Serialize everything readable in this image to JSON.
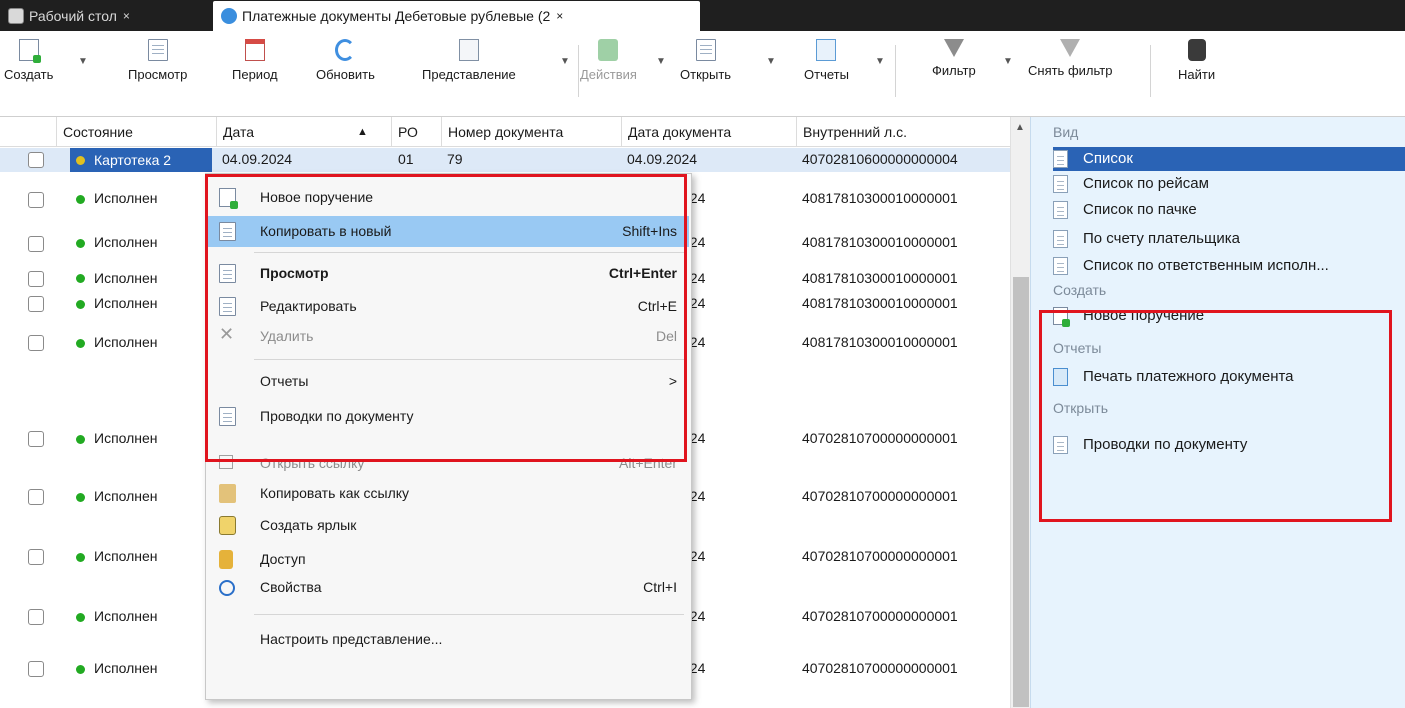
{
  "tabs": [
    {
      "label": "Рабочий стол",
      "close": "×",
      "active": false
    },
    {
      "label": "Платежные документы Дебетовые рублевые (2",
      "close": "×",
      "active": true
    }
  ],
  "toolbar": {
    "create": "Создать",
    "view": "Просмотр",
    "period": "Период",
    "refresh": "Обновить",
    "representation": "Представление",
    "actions": "Действия",
    "open": "Открыть",
    "reports": "Отчеты",
    "filter": "Фильтр",
    "clear_filter": "Снять фильтр",
    "find": "Найти"
  },
  "grid": {
    "columns": [
      "Состояние",
      "Дата",
      "РО",
      "Номер документа",
      "Дата документа",
      "Внутренний л.с."
    ],
    "sort_indicator": "▲",
    "rows": [
      {
        "status": "Картотека 2",
        "date": "04.09.2024",
        "ro": "01",
        "num": "79",
        "docdate": "04.09.2024",
        "account": "40702810600000000004",
        "status_color": "yellow"
      },
      {
        "status": "Исполнен",
        "docdate": "?24",
        "account": "40817810300010000001"
      },
      {
        "status": "Исполнен",
        "docdate": "?24",
        "account": "40817810300010000001"
      },
      {
        "status": "Исполнен",
        "docdate": "?24",
        "account": "40817810300010000001"
      },
      {
        "status": "Исполнен",
        "docdate": "?24",
        "account": "40817810300010000001"
      },
      {
        "status": "Исполнен",
        "docdate": "?24",
        "account": "40817810300010000001"
      },
      {
        "status": "Исполнен",
        "docdate": "?24",
        "account": "40702810700000000001"
      },
      {
        "status": "Исполнен",
        "docdate": "?24",
        "account": "40702810700000000001"
      },
      {
        "status": "Исполнен",
        "docdate": "?24",
        "account": "40702810700000000001"
      },
      {
        "status": "Исполнен",
        "docdate": "?24",
        "account": "40702810700000000001"
      },
      {
        "status": "Исполнен",
        "docdate": "?24",
        "account": "40702810700000000001"
      }
    ]
  },
  "context_menu": {
    "items": [
      {
        "label": "Новое поручение",
        "shortcut": ""
      },
      {
        "label": "Копировать в новый",
        "shortcut": "Shift+Ins"
      },
      {
        "label": "Просмотр",
        "shortcut": "Ctrl+Enter"
      },
      {
        "label": "Редактировать",
        "shortcut": "Ctrl+E"
      },
      {
        "label": "Удалить",
        "shortcut": "Del"
      },
      {
        "label": "Отчеты",
        "shortcut": ">"
      },
      {
        "label": "Проводки по документу",
        "shortcut": ""
      },
      {
        "label": "Открыть ссылку",
        "shortcut": "Alt+Enter"
      },
      {
        "label": "Копировать как ссылку",
        "shortcut": ""
      },
      {
        "label": "Создать ярлык",
        "shortcut": ""
      },
      {
        "label": "Доступ",
        "shortcut": ""
      },
      {
        "label": "Свойства",
        "shortcut": "Ctrl+I"
      },
      {
        "label": "Настроить представление...",
        "shortcut": ""
      }
    ]
  },
  "right_panel": {
    "group_view": "Вид",
    "view_items": [
      "Список",
      "Список по рейсам",
      "Список по пачке",
      "По счету плательщика",
      "Список по ответственным исполн..."
    ],
    "group_create": "Создать",
    "create_item": "Новое поручение",
    "group_reports": "Отчеты",
    "reports_item": "Печать платежного документа",
    "group_open": "Открыть",
    "open_item": "Проводки по документу"
  },
  "colors": {
    "highlight_red": "#e0141e",
    "menu_highlight": "#99c9f3",
    "panel_bg": "#e7f3fd",
    "selected_blue": "#2a63b5"
  }
}
